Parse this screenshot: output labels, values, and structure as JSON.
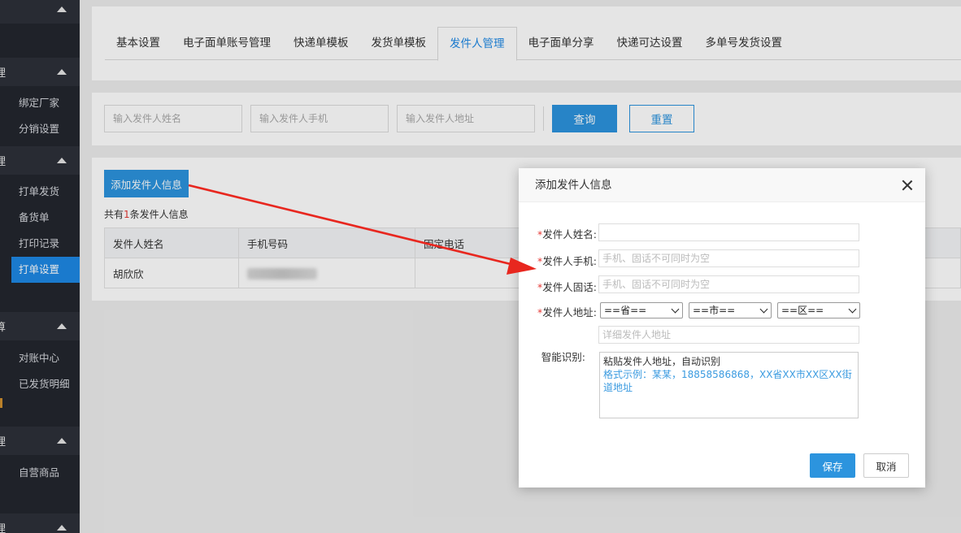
{
  "sidebar": {
    "groups": [
      {
        "title": "理"
      },
      {
        "title": "理"
      },
      {
        "title": "算"
      },
      {
        "title": "理"
      },
      {
        "title": "理"
      }
    ],
    "items": [
      {
        "label": "绑定厂家"
      },
      {
        "label": "分销设置"
      },
      {
        "label": "打单发货"
      },
      {
        "label": "备货单"
      },
      {
        "label": "打印记录"
      },
      {
        "label": "打单设置"
      },
      {
        "label": "对账中心"
      },
      {
        "label": "已发货明细"
      },
      {
        "label": "自营商品"
      }
    ]
  },
  "tabs": [
    {
      "label": "基本设置"
    },
    {
      "label": "电子面单账号管理"
    },
    {
      "label": "快递单模板"
    },
    {
      "label": "发货单模板"
    },
    {
      "label": "发件人管理"
    },
    {
      "label": "电子面单分享"
    },
    {
      "label": "快递可达设置"
    },
    {
      "label": "多单号发货设置"
    }
  ],
  "filter": {
    "name_placeholder": "输入发件人姓名",
    "phone_placeholder": "输入发件人手机",
    "address_placeholder": "输入发件人地址",
    "query_label": "查询",
    "reset_label": "重置"
  },
  "list": {
    "add_label": "添加发件人信息",
    "count_prefix": "共有",
    "count_num": "1",
    "count_suffix": "条发件人信息",
    "columns": [
      "发件人姓名",
      "手机号码",
      "固定电话"
    ],
    "rows": [
      {
        "name": "胡欣欣"
      }
    ]
  },
  "modal": {
    "title": "添加发件人信息",
    "name_label": "发件人姓名:",
    "mobile_label": "发件人手机:",
    "mobile_placeholder": "手机、固话不可同时为空",
    "tel_label": "发件人固话:",
    "tel_placeholder": "手机、固话不可同时为空",
    "address_label": "发件人地址:",
    "province": "==省==",
    "city": "==市==",
    "district": "==区==",
    "detail_placeholder": "详细发件人地址",
    "smart_label": "智能识别:",
    "smart_hint": "粘贴发件人地址，自动识别",
    "smart_example": "格式示例：某某，18858586868，XX省XX市XX区XX街道地址",
    "save_label": "保存",
    "cancel_label": "取消",
    "required_mark": "*"
  },
  "colors": {
    "primary": "#2c94de",
    "sidebar_bg": "#23262e",
    "active_item": "#1e88e5",
    "required": "#e53935",
    "arrow": "#e8271f"
  }
}
